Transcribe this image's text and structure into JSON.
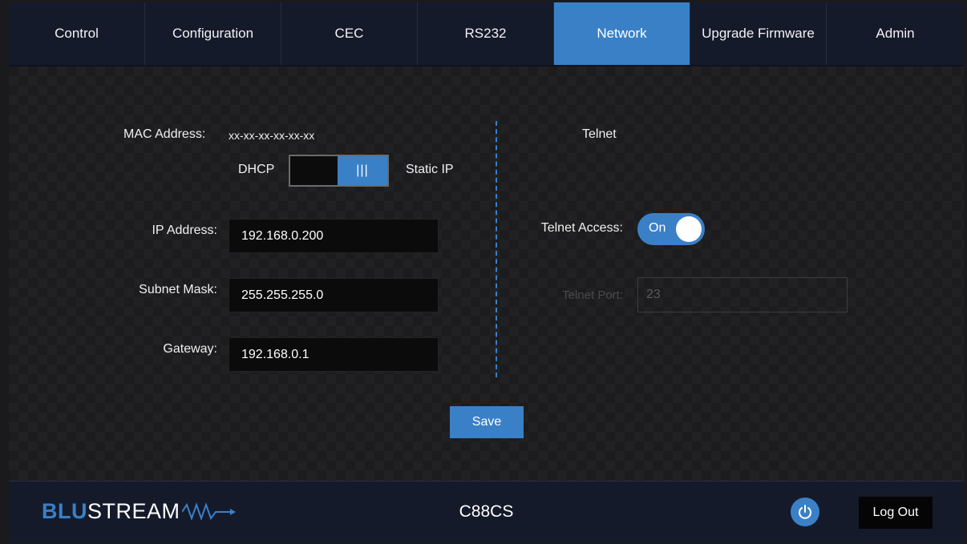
{
  "nav": {
    "tabs": [
      {
        "label": "Control"
      },
      {
        "label": "Configuration"
      },
      {
        "label": "CEC"
      },
      {
        "label": "RS232"
      },
      {
        "label": "Network",
        "active": true
      },
      {
        "label": "Upgrade Firmware"
      },
      {
        "label": "Admin"
      }
    ]
  },
  "network": {
    "mac_label": "MAC Address:",
    "mac_value": "xx-xx-xx-xx-xx-xx",
    "dhcp_label": "DHCP",
    "static_label": "Static IP",
    "dhcp_switch_knob": "|||",
    "mode_selected": "Static IP",
    "ip_label": "IP Address:",
    "ip_value": "192.168.0.200",
    "subnet_label": "Subnet Mask:",
    "subnet_value": "255.255.255.0",
    "gateway_label": "Gateway:",
    "gateway_value": "192.168.0.1"
  },
  "telnet": {
    "heading": "Telnet",
    "access_label": "Telnet Access:",
    "access_state": "On",
    "port_label": "Telnet Port:",
    "port_value": "23"
  },
  "actions": {
    "save_label": "Save"
  },
  "footer": {
    "logo_blu": "BLU",
    "logo_stream": "STREAM",
    "device_name": "C88CS",
    "logout_label": "Log Out",
    "power_icon": "power-icon"
  },
  "colors": {
    "accent": "#3a80c7",
    "nav_bg": "#151a2b",
    "field_bg": "#0b0b0b"
  }
}
